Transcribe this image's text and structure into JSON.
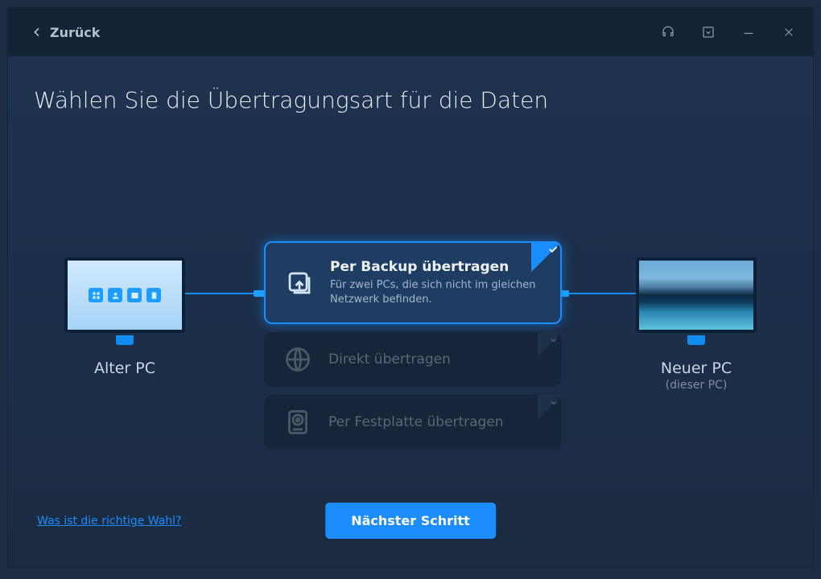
{
  "titlebar": {
    "back_label": "Zurück"
  },
  "page": {
    "title": "Wählen Sie die Übertragungsart für die Daten"
  },
  "pc_old": {
    "label": "Alter PC"
  },
  "pc_new": {
    "label": "Neuer PC",
    "sub": "(dieser PC)"
  },
  "options": [
    {
      "title": "Per Backup übertragen",
      "desc": "Für zwei PCs, die sich nicht im gleichen Netzwerk befinden.",
      "selected": true,
      "icon": "backup"
    },
    {
      "title": "Direkt übertragen",
      "selected": false,
      "icon": "network"
    },
    {
      "title": "Per Festplatte übertragen",
      "selected": false,
      "icon": "disk"
    }
  ],
  "footer": {
    "help_link": "Was ist die richtige Wahl?",
    "next_button": "Nächster Schritt"
  },
  "colors": {
    "accent": "#1b8dff"
  }
}
